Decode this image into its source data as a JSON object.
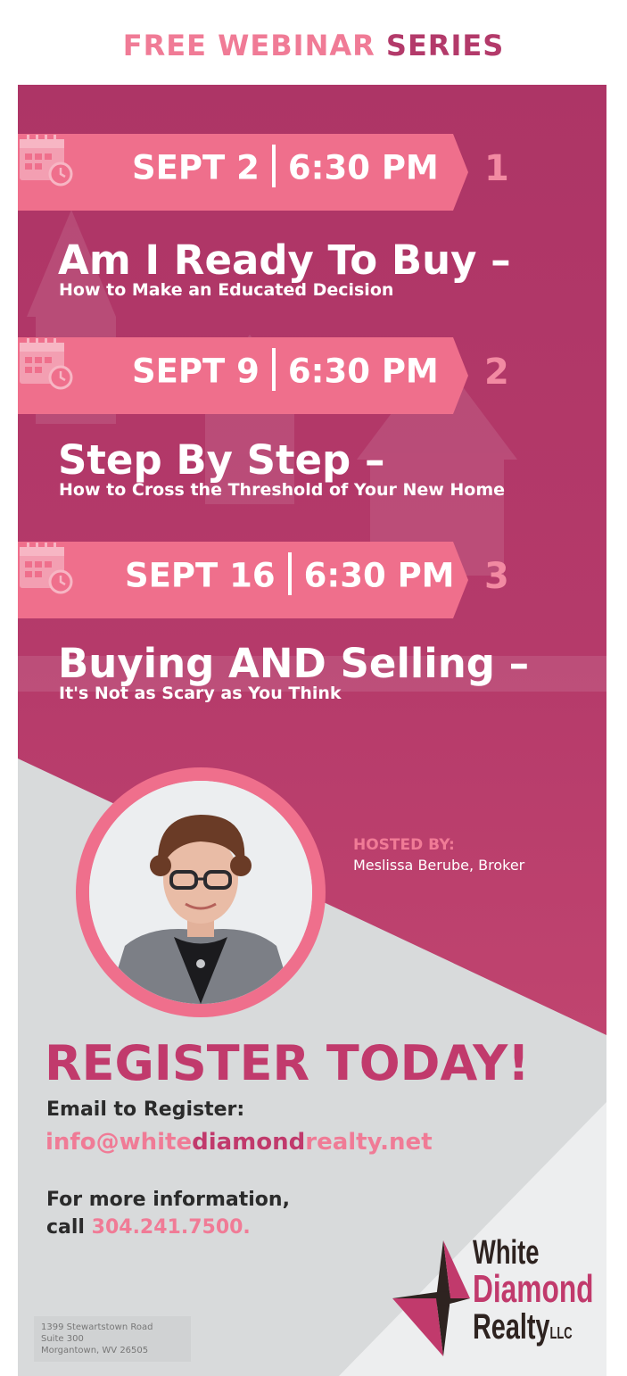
{
  "header": {
    "free_webinar": "FREE WEBINAR",
    "series": "SERIES"
  },
  "sessions": [
    {
      "date": "SEPT 2",
      "time": "6:30 PM",
      "number": "1",
      "title": "Am I Ready To Buy –",
      "subtitle": "How to Make an Educated Decision"
    },
    {
      "date": "SEPT 9",
      "time": "6:30 PM",
      "number": "2",
      "title": "Step By Step –",
      "subtitle": "How to Cross the Threshold of Your New Home"
    },
    {
      "date": "SEPT 16",
      "time": "6:30 PM",
      "number": "3",
      "title": "Buying AND Selling –",
      "subtitle": "It's Not as Scary as You Think"
    }
  ],
  "host": {
    "label": "HOSTED BY:",
    "name": "Meslissa Berube, Broker"
  },
  "register": {
    "headline": "REGISTER TODAY!",
    "email_label": "Email to Register:",
    "email_part1": "info@white",
    "email_part2": "diamond",
    "email_part3": "realty.net",
    "info_line1": "For more information,",
    "info_call": "call",
    "phone": "304.241.7500."
  },
  "address": {
    "line1": "1399 Stewartstown Road",
    "line2": "Suite 300",
    "line3": "Morgantown, WV 26505"
  },
  "logo": {
    "line1": "White",
    "line2": "Diamond",
    "line3": "Realty",
    "suffix": "LLC"
  },
  "colors": {
    "magenta": "#b4396b",
    "ribbon": "#ef6f8c",
    "accent": "#f07b96",
    "dark_pink": "#c13a6c",
    "gray": "#d8dadb"
  }
}
